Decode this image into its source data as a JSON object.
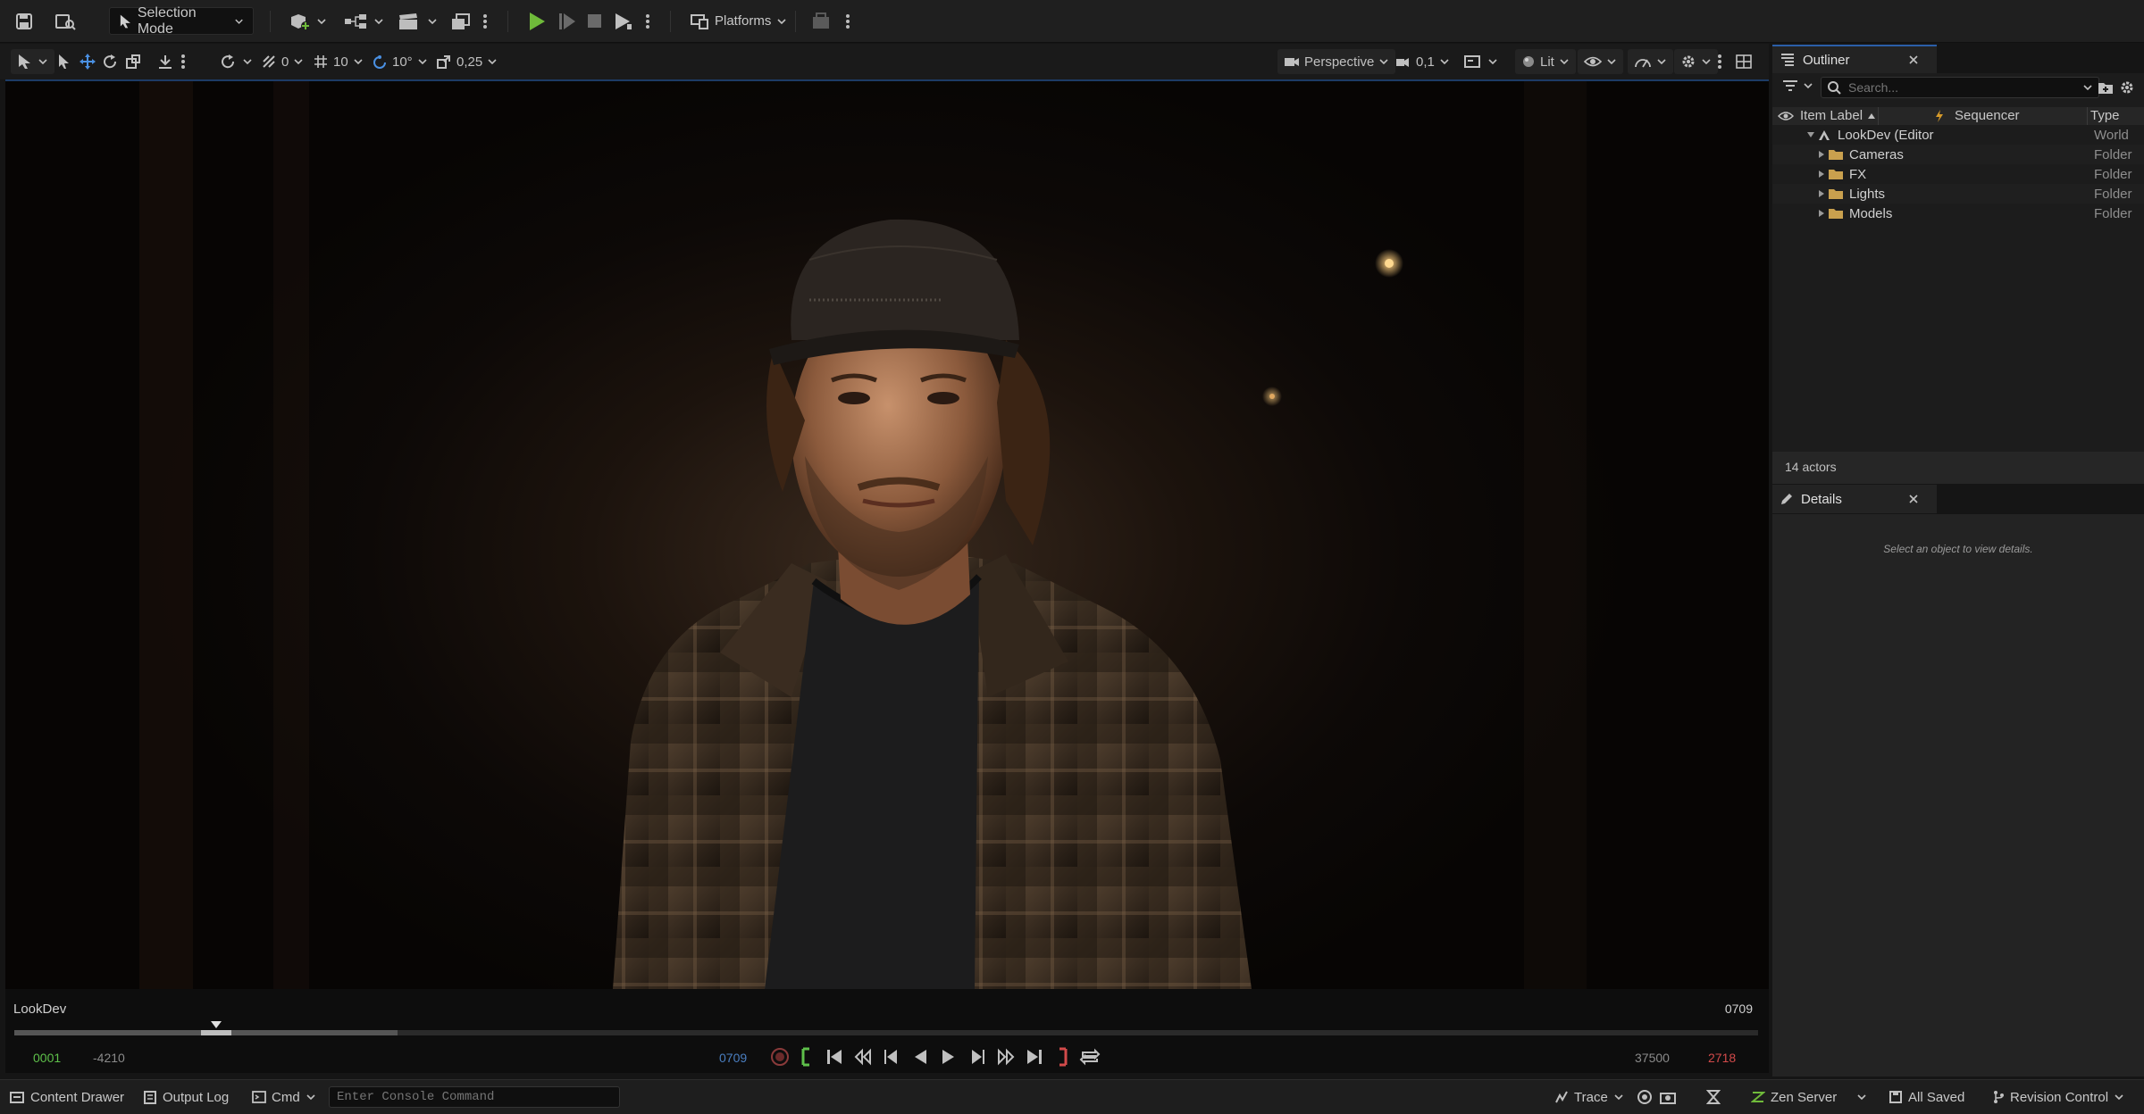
{
  "toolbar": {
    "selection_mode": "Selection Mode",
    "platforms": "Platforms"
  },
  "viewport_toolbar": {
    "translate_snap": "0",
    "grid_snap": "10",
    "rotate_snap": "10°",
    "scale_snap": "0,25",
    "view_mode": "Perspective",
    "camera_speed": "0,1",
    "lighting": "Lit"
  },
  "viewport": {
    "level_name": "LookDev",
    "frame_right": "0709"
  },
  "timeline": {
    "start_frame": "0001",
    "view_start": "-4210",
    "current_frame": "0709",
    "view_end": "37500",
    "end_frame": "2718",
    "playhead_fraction": 0.116
  },
  "outliner": {
    "tab_title": "Outliner",
    "search_placeholder": "Search...",
    "columns": {
      "label": "Item Label",
      "sequencer": "Sequencer",
      "type": "Type"
    },
    "rows": [
      {
        "label": "LookDev (Editor",
        "type": "World"
      },
      {
        "label": "Cameras",
        "type": "Folder"
      },
      {
        "label": "FX",
        "type": "Folder"
      },
      {
        "label": "Lights",
        "type": "Folder"
      },
      {
        "label": "Models",
        "type": "Folder"
      }
    ],
    "actor_count": "14 actors"
  },
  "details": {
    "tab_title": "Details",
    "empty_text": "Select an object to view details."
  },
  "statusbar": {
    "content_drawer": "Content Drawer",
    "output_log": "Output Log",
    "cmd": "Cmd",
    "console_placeholder": "Enter Console Command",
    "trace": "Trace",
    "zen_server": "Zen Server",
    "all_saved": "All Saved",
    "revision_control": "Revision Control"
  },
  "colors": {
    "play_green": "#6fba3a",
    "accent_blue": "#2b5ea8",
    "folder_orange": "#c9a04e",
    "frame_green": "#5ec04a",
    "frame_red": "#d24a4a"
  }
}
